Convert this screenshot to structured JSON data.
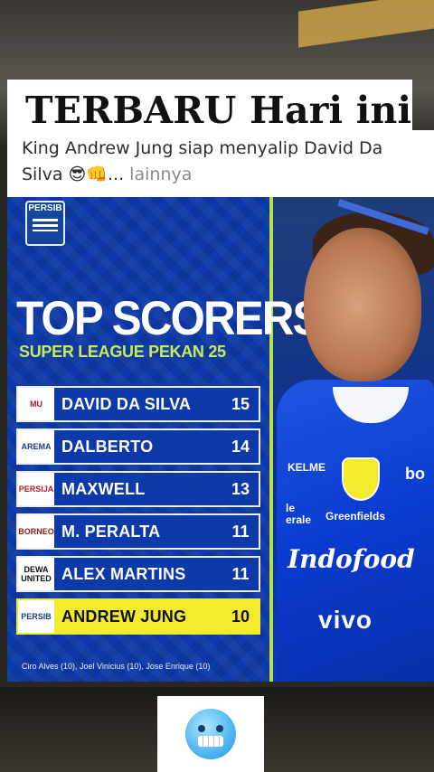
{
  "post": {
    "headline": "TERBARU Hari ini",
    "caption": "King Andrew Jung siap menyalip David Da Silva 😎👊...",
    "more_label": " lainnya"
  },
  "poster": {
    "club_logo_text": "PERSIB",
    "title": "TOP SCORERS",
    "subtitle": "SUPER LEAGUE PEKAN 25",
    "footnote": "Ciro Alves (10), Joel Vinicius (10), Jose Enrique (10)",
    "scorers": [
      {
        "badge": "MU",
        "name": "DAVID DA SILVA",
        "goals": "15"
      },
      {
        "badge": "AREMA",
        "name": "DALBERTO",
        "goals": "14"
      },
      {
        "badge": "PERSIJA",
        "name": "MAXWELL",
        "goals": "13"
      },
      {
        "badge": "BORNEO",
        "name": "M. PERALTA",
        "goals": "11"
      },
      {
        "badge": "DEWA UNITED",
        "name": "ALEX MARTINS",
        "goals": "11"
      },
      {
        "badge": "PERSIB",
        "name": "ANDREW JUNG",
        "goals": "10"
      }
    ],
    "sponsors": {
      "kelme": "KELME",
      "le": "le\nerale",
      "greenfields": "Greenfields",
      "indofood": "Indofood",
      "vivo": "vivo",
      "bo": "bo"
    }
  },
  "reaction": {
    "icon": "cold-face-emoji-icon"
  },
  "colors": {
    "poster_blue": "#0e3aa9",
    "accent_green": "#c8eb56",
    "highlight_yellow": "#f2ea2c"
  }
}
